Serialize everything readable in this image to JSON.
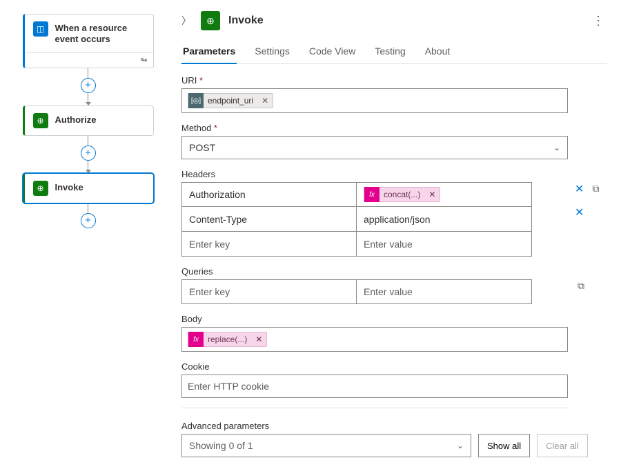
{
  "canvas": {
    "trigger": {
      "label": "When a resource event occurs"
    },
    "actions": [
      {
        "label": "Authorize"
      },
      {
        "label": "Invoke"
      }
    ]
  },
  "panel": {
    "title": "Invoke",
    "tabs": [
      "Parameters",
      "Settings",
      "Code View",
      "Testing",
      "About"
    ],
    "activeTab": "Parameters",
    "fields": {
      "uri": {
        "label": "URI",
        "token": "endpoint_uri"
      },
      "method": {
        "label": "Method",
        "value": "POST"
      },
      "headers": {
        "label": "Headers",
        "rows": [
          {
            "key": "Authorization",
            "valueToken": "concat(...)"
          },
          {
            "key": "Content-Type",
            "value": "application/json"
          }
        ],
        "placeholderKey": "Enter key",
        "placeholderValue": "Enter value"
      },
      "queries": {
        "label": "Queries",
        "placeholderKey": "Enter key",
        "placeholderValue": "Enter value"
      },
      "body": {
        "label": "Body",
        "token": "replace(...)"
      },
      "cookie": {
        "label": "Cookie",
        "placeholder": "Enter HTTP cookie"
      },
      "advanced": {
        "label": "Advanced parameters",
        "summary": "Showing 0 of 1",
        "showAll": "Show all",
        "clearAll": "Clear all"
      }
    }
  }
}
